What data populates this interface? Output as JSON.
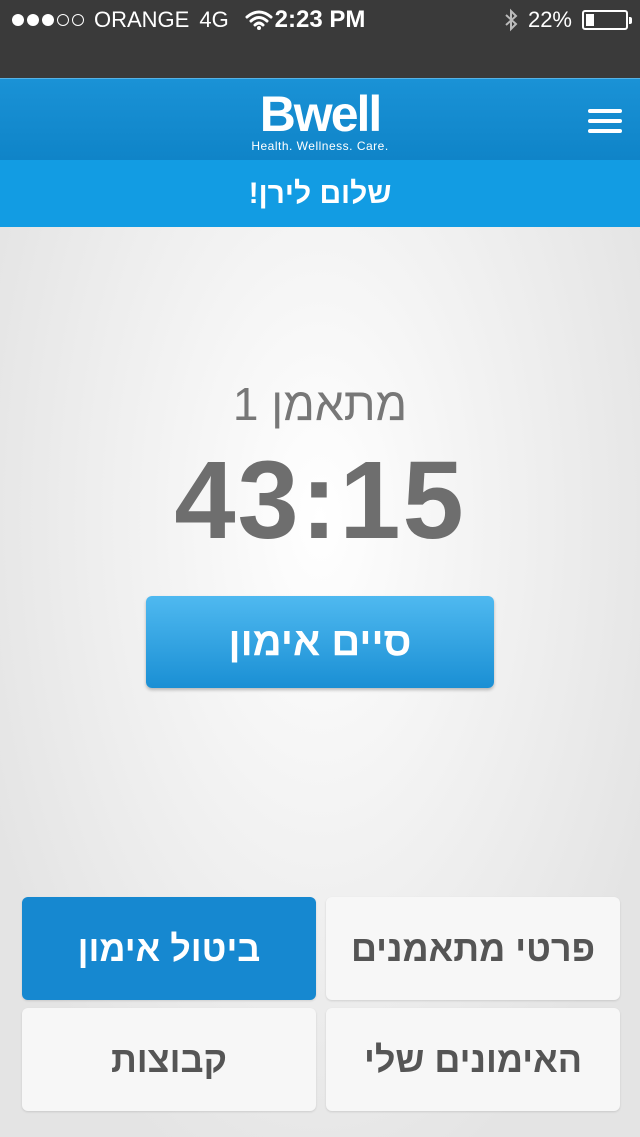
{
  "status": {
    "carrier": "ORANGE",
    "network": "4G",
    "time": "2:23 PM",
    "battery_text": "22%",
    "battery_level": 0.22
  },
  "header": {
    "logo_main": "Bwell",
    "logo_tagline": "Health. Wellness. Care."
  },
  "greeting": "שלום לירן!",
  "session": {
    "trainee_label": "מתאמן 1",
    "timer": "43:15",
    "end_button": "סיים אימון"
  },
  "actions": {
    "cancel_workout": "ביטול אימון",
    "trainee_details": "פרטי מתאמנים",
    "groups": "קבוצות",
    "my_workouts": "האימונים שלי"
  },
  "colors": {
    "brand_blue": "#1688d0",
    "header_blue": "#129ce3"
  }
}
